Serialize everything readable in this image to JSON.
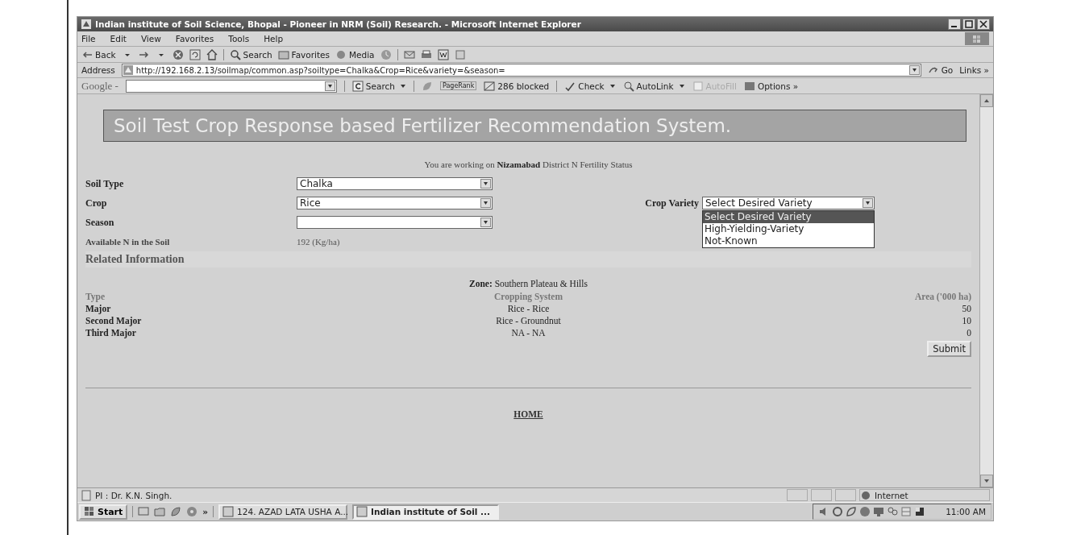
{
  "window": {
    "title": "Indian institute of Soil Science, Bhopal - Pioneer in NRM (Soil) Research. - Microsoft Internet Explorer"
  },
  "menu": [
    "File",
    "Edit",
    "View",
    "Favorites",
    "Tools",
    "Help"
  ],
  "toolbar": {
    "back": "Back",
    "search": "Search",
    "favorites": "Favorites",
    "media": "Media"
  },
  "address": {
    "label": "Address",
    "url": "http://192.168.2.13/soilmap/common.asp?soiltype=Chalka&Crop=Rice&variety=&season=",
    "go": "Go",
    "links": "Links »"
  },
  "google_bar": {
    "logo": "Google -",
    "search": "Search",
    "pagerank": "PageRank",
    "blocked": "286 blocked",
    "check": "Check",
    "autolink": "AutoLink",
    "autofill": "AutoFill",
    "options": "Options »"
  },
  "page": {
    "banner": "Soil Test Crop Response based Fertilizer Recommendation System.",
    "context": "You are working on **Nizamabad** District N Fertility Status",
    "fields": [
      {
        "label": "Soil Type",
        "value": "Chalka"
      },
      {
        "label": "Crop",
        "value": "Rice"
      },
      {
        "label": "Season"
      }
    ],
    "variety": {
      "label": "Crop Variety",
      "value": "Select Desired Variety",
      "options": [
        {
          "label": "Select Desired Variety",
          "selected": true
        },
        {
          "label": "High-Yielding-Variety",
          "selected": false
        },
        {
          "label": "Not-Known",
          "selected": false
        }
      ]
    },
    "available_n": {
      "label": "Available N in the Soil",
      "value": "192 (Kg/ha)"
    },
    "related_heading": "Related Information",
    "zone": "**Zone:** Southern Plateau & Hills",
    "table": {
      "columns": [
        "Type",
        "Cropping System",
        "Area ('000 ha)"
      ],
      "rows": [
        [
          "Major",
          "Rice - Rice",
          "50"
        ],
        [
          "Second Major",
          "Rice - Groundnut",
          "10"
        ],
        [
          "Third Major",
          "NA - NA",
          "0"
        ]
      ]
    },
    "submit": "Submit",
    "home": "HOME"
  },
  "status_bar": {
    "text": "PI : Dr. K.N. Singh.",
    "zone": "Internet"
  },
  "taskbar": {
    "start": "Start",
    "more": "»",
    "tasks": [
      {
        "label": "124. AZAD LATA USHA A...",
        "selected": false
      },
      {
        "label": "Indian institute of Soil ...",
        "selected": true
      }
    ],
    "time": "11:00 AM"
  }
}
